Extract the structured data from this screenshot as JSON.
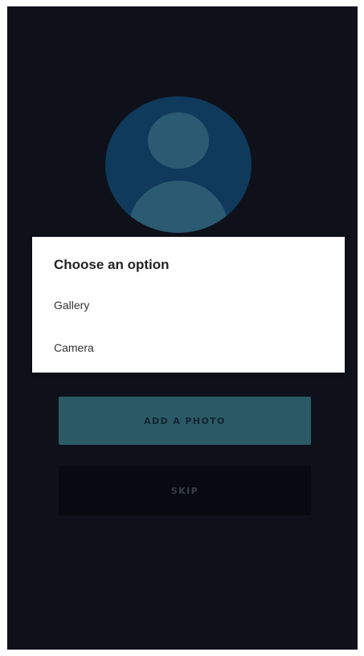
{
  "dialog": {
    "title": "Choose an option",
    "options": [
      {
        "label": "Gallery"
      },
      {
        "label": "Camera"
      }
    ]
  },
  "buttons": {
    "add_photo_label": "ADD A PHOTO",
    "skip_label": "SKIP"
  },
  "avatar": {
    "icon": "person-placeholder-icon"
  },
  "colors": {
    "background": "#0e111a",
    "avatar_circle": "#0f3a5c",
    "avatar_figure": "#2a5b72",
    "add_photo_button": "#2b5a66",
    "skip_button": "#080a11",
    "dialog_background": "#ffffff"
  }
}
